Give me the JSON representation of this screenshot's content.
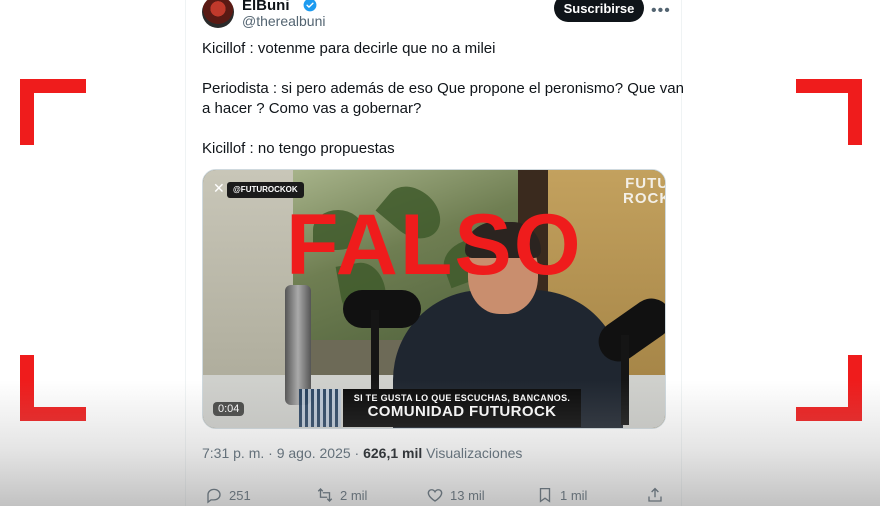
{
  "author": {
    "display_name": "ElBuni",
    "handle": "@therealbuni",
    "verified": true
  },
  "header": {
    "subscribe_label": "Suscribirse",
    "more_icon": "ellipsis-icon"
  },
  "tweet": {
    "lines": [
      "Kicillof : votenme para decirle que no a milei",
      "Periodista : si pero además de eso  Que propone el peronismo? Que van",
      "a hacer ? Como vas a gobernar?",
      "Kicillof : no tengo propuestas"
    ]
  },
  "media": {
    "channel_tag": "@FUTUROCKOK",
    "brand_logo": "FUTU ROCK",
    "banner_top": "SI TE GUSTA LO QUE ESCUCHAS, BANCANOS.",
    "banner_main": "COMUNIDAD FUTUROCK",
    "duration": "0:04",
    "stamp": "FALSO"
  },
  "meta": {
    "timestamp": "7:31 p. m. · 9 ago. 2025 · ",
    "views_count": "626,1 mil",
    "views_label": " Visualizaciones"
  },
  "actions": {
    "replies": "251",
    "reposts": "2 mil",
    "likes": "13 mil",
    "bookmarks": "1 mil"
  },
  "colors": {
    "stamp_red": "#ef1c1c",
    "text_primary": "#0f1419",
    "text_secondary": "#536471",
    "verified_blue": "#1d9bf0"
  }
}
